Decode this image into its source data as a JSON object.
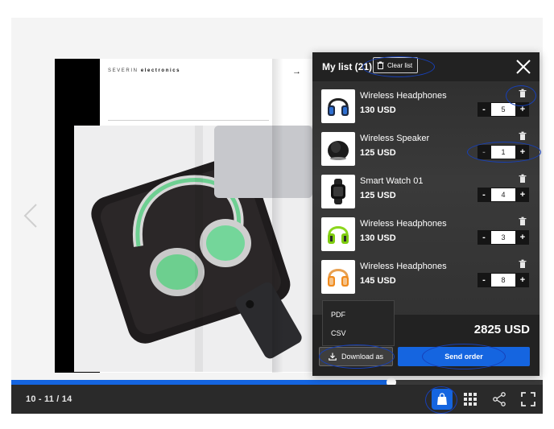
{
  "catalog": {
    "brand_light": "SEVERIN ",
    "brand_bold": "electronics",
    "page_arrow": "→"
  },
  "toolbar": {
    "page_indicator": "10 - 11 / 14",
    "progress_fraction": 0.715,
    "accent_color": "#1565e0"
  },
  "cart": {
    "title": "My list (21)",
    "clear_label": "Clear list",
    "items": [
      {
        "name": "Wireless Headphones",
        "price": "130 USD",
        "qty": "5",
        "thumb": "headphones-dark-blue"
      },
      {
        "name": "Wireless Speaker",
        "price": "125 USD",
        "qty": "1",
        "thumb": "speaker-black"
      },
      {
        "name": "Smart Watch 01",
        "price": "125 USD",
        "qty": "4",
        "thumb": "smartwatch-black"
      },
      {
        "name": "Wireless Headphones",
        "price": "130 USD",
        "qty": "3",
        "thumb": "headphones-lime"
      },
      {
        "name": "Wireless Headphones",
        "price": "145 USD",
        "qty": "8",
        "thumb": "headphones-orange"
      }
    ],
    "minus": "-",
    "plus": "+",
    "total": "2825 USD",
    "download_label": "Download as",
    "download_options": [
      "PDF",
      "CSV"
    ],
    "send_label": "Send order"
  }
}
